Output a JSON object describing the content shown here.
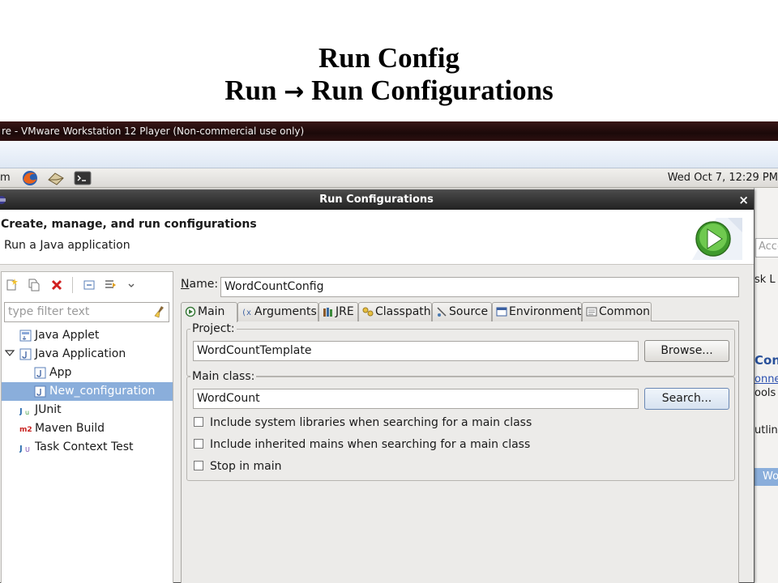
{
  "slide": {
    "title_line1": "Run Config",
    "title_line2_a": "Run",
    "title_line2_arrow": "→",
    "title_line2_b": "Run Configurations"
  },
  "vm": {
    "title": "re - VMware Workstation 12 Player (Non-commercial use only)"
  },
  "panel": {
    "menu_fragment": "m",
    "clock": "Wed Oct  7, 12:29 PM",
    "launchers": [
      "firefox-icon",
      "mail-icon",
      "terminal-icon"
    ]
  },
  "background_fragments": {
    "acc": "Acce",
    "task": "sk L",
    "conn": "Conn",
    "onne": "onne",
    "tools": "ools",
    "outline": "utlin",
    "wo": "Wo"
  },
  "dialog": {
    "title": "Run Configurations",
    "close": "×",
    "header_title": "Create, manage, and run configurations",
    "header_subtitle": "Run a Java application"
  },
  "left": {
    "filter_placeholder": "type filter text",
    "tree": [
      {
        "label": "Java Applet",
        "icon": "java-applet-icon",
        "level": 1
      },
      {
        "label": "Java Application",
        "icon": "java-application-icon",
        "level": 0,
        "expanded": true
      },
      {
        "label": "App",
        "icon": "java-config-icon",
        "level": 2
      },
      {
        "label": "New_configuration",
        "icon": "java-config-icon",
        "level": 2,
        "selected": true
      },
      {
        "label": "JUnit",
        "icon": "junit-icon",
        "level": 1
      },
      {
        "label": "Maven Build",
        "icon": "maven-icon",
        "level": 1
      },
      {
        "label": "Task Context Test",
        "icon": "task-context-icon",
        "level": 1
      }
    ]
  },
  "right": {
    "name_label": "Name:",
    "name_label_mnemonic": "N",
    "name_label_rest": "ame:",
    "name_value": "WordCountConfig",
    "tabs": [
      {
        "label": "Main",
        "icon": "main-tab-icon",
        "active": true
      },
      {
        "label": "Arguments",
        "icon": "arguments-tab-icon"
      },
      {
        "label": "JRE",
        "icon": "jre-tab-icon"
      },
      {
        "label": "Classpath",
        "icon": "classpath-tab-icon"
      },
      {
        "label": "Source",
        "icon": "source-tab-icon"
      },
      {
        "label": "Environment",
        "icon": "environment-tab-icon"
      },
      {
        "label": "Common",
        "icon": "common-tab-icon"
      }
    ],
    "project_label": "Project:",
    "project_value": "WordCountTemplate",
    "browse_label": "Browse...",
    "main_class_label": "Main class:",
    "main_class_value": "WordCount",
    "search_label": "Search...",
    "checkboxes": [
      {
        "label": "Include system libraries when searching for a main class",
        "checked": false
      },
      {
        "label": "Include inherited mains when searching for a main class",
        "checked": false
      },
      {
        "label": "Stop in main",
        "checked": false
      }
    ]
  }
}
